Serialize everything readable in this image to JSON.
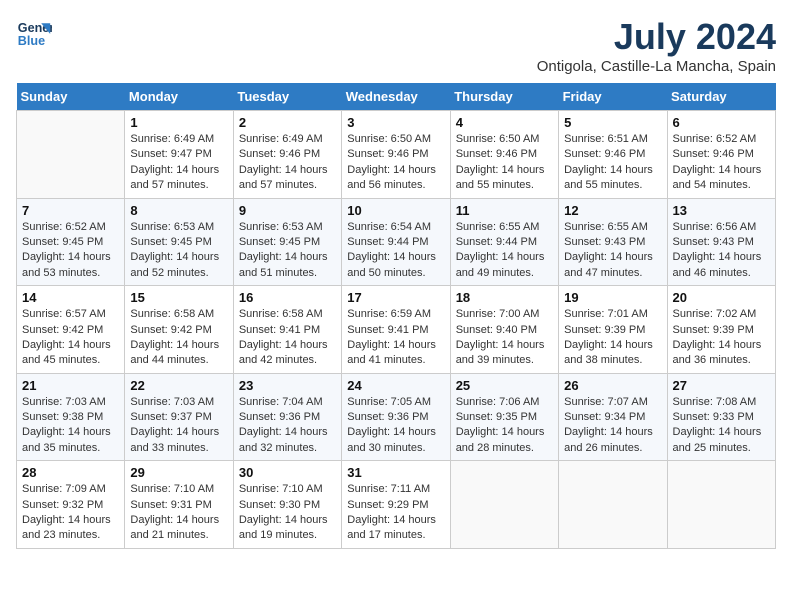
{
  "logo": {
    "text_general": "General",
    "text_blue": "Blue"
  },
  "title": "July 2024",
  "subtitle": "Ontigola, Castille-La Mancha, Spain",
  "headers": [
    "Sunday",
    "Monday",
    "Tuesday",
    "Wednesday",
    "Thursday",
    "Friday",
    "Saturday"
  ],
  "weeks": [
    [
      {
        "day": "",
        "info": ""
      },
      {
        "day": "1",
        "info": "Sunrise: 6:49 AM\nSunset: 9:47 PM\nDaylight: 14 hours\nand 57 minutes."
      },
      {
        "day": "2",
        "info": "Sunrise: 6:49 AM\nSunset: 9:46 PM\nDaylight: 14 hours\nand 57 minutes."
      },
      {
        "day": "3",
        "info": "Sunrise: 6:50 AM\nSunset: 9:46 PM\nDaylight: 14 hours\nand 56 minutes."
      },
      {
        "day": "4",
        "info": "Sunrise: 6:50 AM\nSunset: 9:46 PM\nDaylight: 14 hours\nand 55 minutes."
      },
      {
        "day": "5",
        "info": "Sunrise: 6:51 AM\nSunset: 9:46 PM\nDaylight: 14 hours\nand 55 minutes."
      },
      {
        "day": "6",
        "info": "Sunrise: 6:52 AM\nSunset: 9:46 PM\nDaylight: 14 hours\nand 54 minutes."
      }
    ],
    [
      {
        "day": "7",
        "info": "Sunrise: 6:52 AM\nSunset: 9:45 PM\nDaylight: 14 hours\nand 53 minutes."
      },
      {
        "day": "8",
        "info": "Sunrise: 6:53 AM\nSunset: 9:45 PM\nDaylight: 14 hours\nand 52 minutes."
      },
      {
        "day": "9",
        "info": "Sunrise: 6:53 AM\nSunset: 9:45 PM\nDaylight: 14 hours\nand 51 minutes."
      },
      {
        "day": "10",
        "info": "Sunrise: 6:54 AM\nSunset: 9:44 PM\nDaylight: 14 hours\nand 50 minutes."
      },
      {
        "day": "11",
        "info": "Sunrise: 6:55 AM\nSunset: 9:44 PM\nDaylight: 14 hours\nand 49 minutes."
      },
      {
        "day": "12",
        "info": "Sunrise: 6:55 AM\nSunset: 9:43 PM\nDaylight: 14 hours\nand 47 minutes."
      },
      {
        "day": "13",
        "info": "Sunrise: 6:56 AM\nSunset: 9:43 PM\nDaylight: 14 hours\nand 46 minutes."
      }
    ],
    [
      {
        "day": "14",
        "info": "Sunrise: 6:57 AM\nSunset: 9:42 PM\nDaylight: 14 hours\nand 45 minutes."
      },
      {
        "day": "15",
        "info": "Sunrise: 6:58 AM\nSunset: 9:42 PM\nDaylight: 14 hours\nand 44 minutes."
      },
      {
        "day": "16",
        "info": "Sunrise: 6:58 AM\nSunset: 9:41 PM\nDaylight: 14 hours\nand 42 minutes."
      },
      {
        "day": "17",
        "info": "Sunrise: 6:59 AM\nSunset: 9:41 PM\nDaylight: 14 hours\nand 41 minutes."
      },
      {
        "day": "18",
        "info": "Sunrise: 7:00 AM\nSunset: 9:40 PM\nDaylight: 14 hours\nand 39 minutes."
      },
      {
        "day": "19",
        "info": "Sunrise: 7:01 AM\nSunset: 9:39 PM\nDaylight: 14 hours\nand 38 minutes."
      },
      {
        "day": "20",
        "info": "Sunrise: 7:02 AM\nSunset: 9:39 PM\nDaylight: 14 hours\nand 36 minutes."
      }
    ],
    [
      {
        "day": "21",
        "info": "Sunrise: 7:03 AM\nSunset: 9:38 PM\nDaylight: 14 hours\nand 35 minutes."
      },
      {
        "day": "22",
        "info": "Sunrise: 7:03 AM\nSunset: 9:37 PM\nDaylight: 14 hours\nand 33 minutes."
      },
      {
        "day": "23",
        "info": "Sunrise: 7:04 AM\nSunset: 9:36 PM\nDaylight: 14 hours\nand 32 minutes."
      },
      {
        "day": "24",
        "info": "Sunrise: 7:05 AM\nSunset: 9:36 PM\nDaylight: 14 hours\nand 30 minutes."
      },
      {
        "day": "25",
        "info": "Sunrise: 7:06 AM\nSunset: 9:35 PM\nDaylight: 14 hours\nand 28 minutes."
      },
      {
        "day": "26",
        "info": "Sunrise: 7:07 AM\nSunset: 9:34 PM\nDaylight: 14 hours\nand 26 minutes."
      },
      {
        "day": "27",
        "info": "Sunrise: 7:08 AM\nSunset: 9:33 PM\nDaylight: 14 hours\nand 25 minutes."
      }
    ],
    [
      {
        "day": "28",
        "info": "Sunrise: 7:09 AM\nSunset: 9:32 PM\nDaylight: 14 hours\nand 23 minutes."
      },
      {
        "day": "29",
        "info": "Sunrise: 7:10 AM\nSunset: 9:31 PM\nDaylight: 14 hours\nand 21 minutes."
      },
      {
        "day": "30",
        "info": "Sunrise: 7:10 AM\nSunset: 9:30 PM\nDaylight: 14 hours\nand 19 minutes."
      },
      {
        "day": "31",
        "info": "Sunrise: 7:11 AM\nSunset: 9:29 PM\nDaylight: 14 hours\nand 17 minutes."
      },
      {
        "day": "",
        "info": ""
      },
      {
        "day": "",
        "info": ""
      },
      {
        "day": "",
        "info": ""
      }
    ]
  ]
}
